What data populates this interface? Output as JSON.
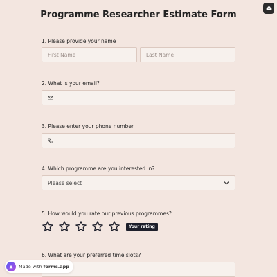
{
  "form": {
    "title": "Programme Researcher Estimate Form",
    "q1": {
      "label": "1.  Please provide your name",
      "first_placeholder": "First Name",
      "last_placeholder": "Last Name"
    },
    "q2": {
      "label": "2.  What is your email?",
      "icon": "envelope-icon"
    },
    "q3": {
      "label": "3.  Please enter your phone number",
      "icon": "phone-icon"
    },
    "q4": {
      "label": "4.  Which programme are you interested in?",
      "select_value": "Please select"
    },
    "q5": {
      "label": "5.  How would you rate our previous programmes?",
      "star_count": 5,
      "badge": "Your rating"
    },
    "q6": {
      "label": "6.  What are your preferred time slots?"
    }
  },
  "branding": {
    "made_with": "Made with",
    "brand": "forms.app"
  },
  "colors": {
    "background": "#f3e6e0",
    "field_bg": "#f7f1ed",
    "field_border": "#dcc9c0",
    "badge_bg": "#1d1f2b"
  }
}
